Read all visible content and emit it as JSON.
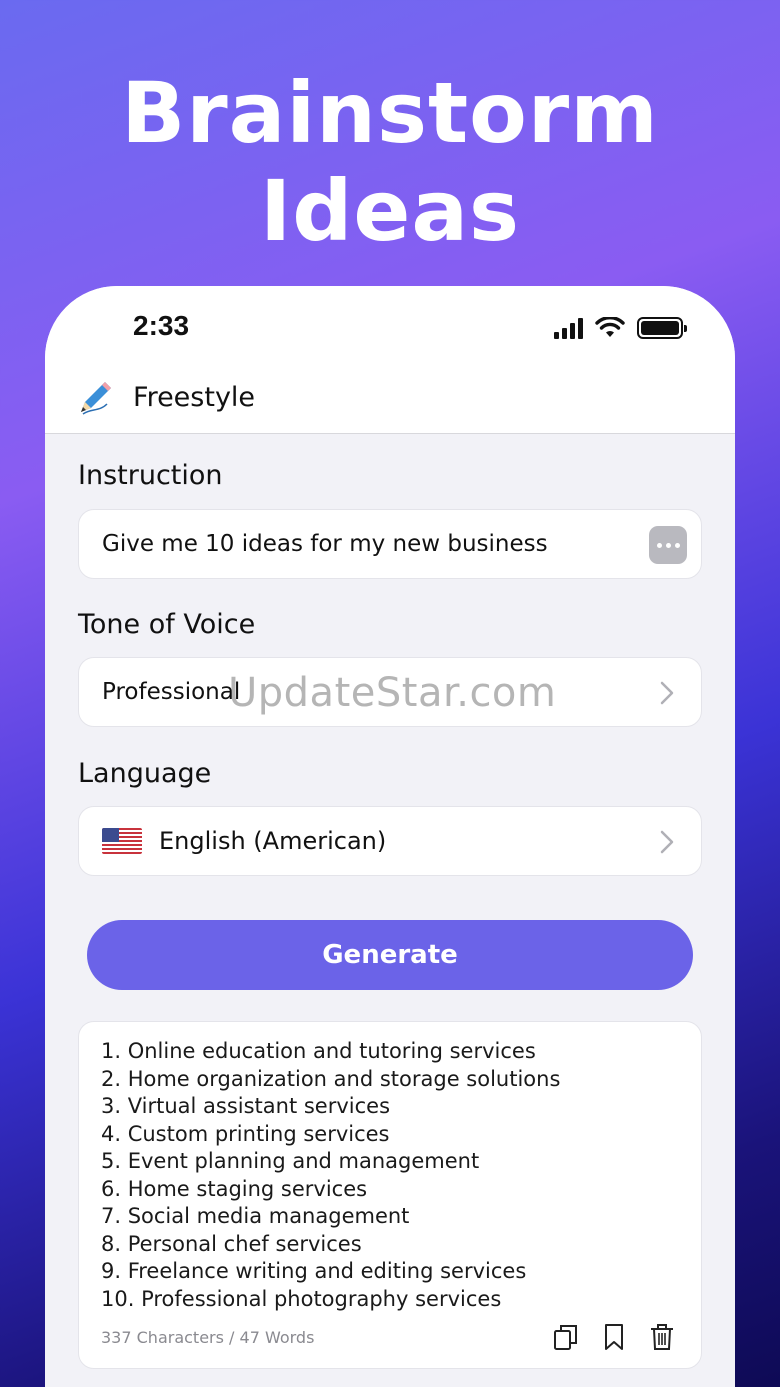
{
  "headline": {
    "line1": "Brainstorm",
    "line2": "Ideas"
  },
  "status_bar": {
    "time": "2:33"
  },
  "app": {
    "title": "Freestyle",
    "icon": "pencil-icon"
  },
  "instruction": {
    "label": "Instruction",
    "value": "Give me 10 ideas for my new business"
  },
  "tone": {
    "label": "Tone of Voice",
    "value": "Professional"
  },
  "language": {
    "label": "Language",
    "value": "English (American)",
    "flag": "us-flag-icon"
  },
  "watermark": "UpdateStar.com",
  "generate_label": "Generate",
  "result": {
    "items": [
      "1. Online education and tutoring services",
      "2. Home organization and storage solutions",
      "3. Virtual assistant services",
      "4. Custom printing services",
      "5. Event planning and management",
      "6. Home staging services",
      "7. Social media management",
      "8. Personal chef services",
      "9. Freelance writing and editing services",
      "10. Professional photography services"
    ],
    "stats": "337 Characters / 47 Words",
    "actions": [
      "copy-icon",
      "bookmark-icon",
      "trash-icon"
    ]
  },
  "colors": {
    "accent": "#6b63e8",
    "background_top": "#8a5cf2",
    "background_bottom": "#0e0a55"
  }
}
